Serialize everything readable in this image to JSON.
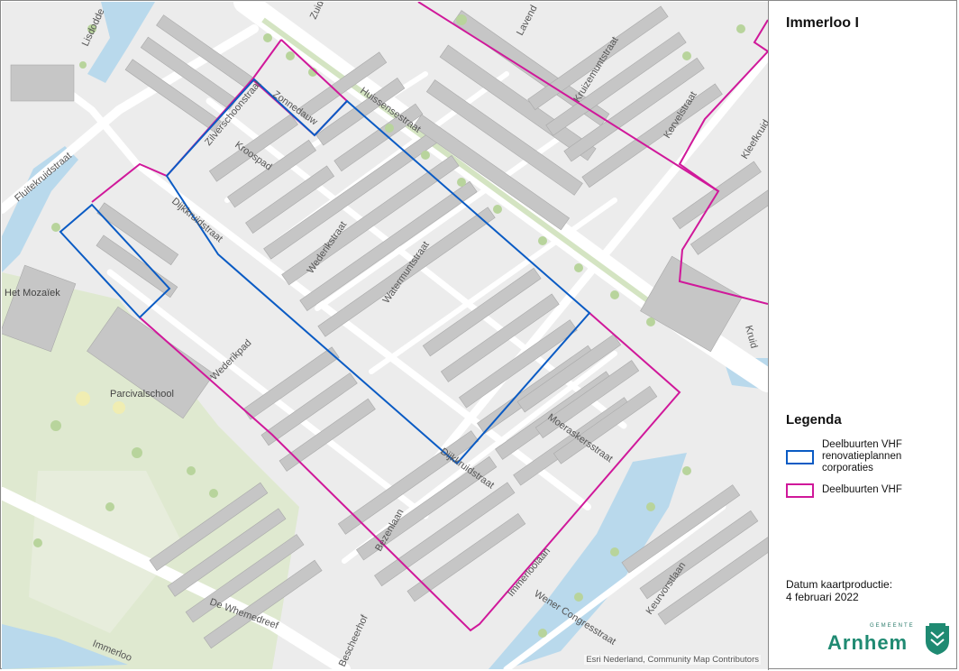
{
  "map": {
    "title": "Immerloo I",
    "streets": [
      {
        "name": "Lisdodde",
        "id": "lisdodde"
      },
      {
        "name": "Zuid",
        "id": "zuid"
      },
      {
        "name": "Lavend",
        "id": "lavend"
      },
      {
        "name": "Huissensestraat",
        "id": "huissensestraat"
      },
      {
        "name": "Kruizemuntstraat",
        "id": "kruizemuntstraat"
      },
      {
        "name": "Kervelstraat",
        "id": "kervelstraat"
      },
      {
        "name": "Kleefkruid",
        "id": "kleefkruid"
      },
      {
        "name": "Fluitekruidstraat",
        "id": "fluitekruidstraat"
      },
      {
        "name": "Zilverschoonstraat",
        "id": "zilverschoonstraat"
      },
      {
        "name": "Zonnedauw",
        "id": "zonnedauw"
      },
      {
        "name": "Kroospad",
        "id": "kroospad"
      },
      {
        "name": "Dijkkruidstraat",
        "id": "dijkkruidstraat-n"
      },
      {
        "name": "Wederikstraat",
        "id": "wederikstraat"
      },
      {
        "name": "Watermuntstraat",
        "id": "watermuntstraat"
      },
      {
        "name": "Wederikpad",
        "id": "wederikpad"
      },
      {
        "name": "Moeraskersstraat",
        "id": "moeraskersstraat"
      },
      {
        "name": "Dijkkruidstraat",
        "id": "dijkkruidstraat-s"
      },
      {
        "name": "Bezenlaan",
        "id": "bezenlaan"
      },
      {
        "name": "Immerloolaan",
        "id": "immerloolaan"
      },
      {
        "name": "Wener Congresstraat",
        "id": "wenercongres"
      },
      {
        "name": "Keurvorstlaan",
        "id": "keurvorstlaan"
      },
      {
        "name": "De Whemedreef",
        "id": "whemedreef"
      },
      {
        "name": "Immerloo",
        "id": "immerloo"
      },
      {
        "name": "Bescheerhof",
        "id": "bescheerhof"
      },
      {
        "name": "Kruid",
        "id": "kruid"
      }
    ],
    "places": [
      {
        "name": "Het Mozaïek",
        "id": "mozaiek"
      },
      {
        "name": "Parcivalschool",
        "id": "parcival"
      }
    ],
    "credits": "Esri Nederland, Community Map Contributors"
  },
  "legend": {
    "title": "Legenda",
    "items": [
      {
        "label": "Deelbuurten VHF renovatieplannen corporaties",
        "color": "#0a5bc4"
      },
      {
        "label": "Deelbuurten VHF",
        "color": "#d0189a"
      }
    ]
  },
  "production": {
    "label": "Datum kaartproductie:",
    "date": "4 februari 2022"
  },
  "logo": {
    "small": "GEMEENTE",
    "word": "Arnhem",
    "icon": "arnhem-crest-icon"
  }
}
